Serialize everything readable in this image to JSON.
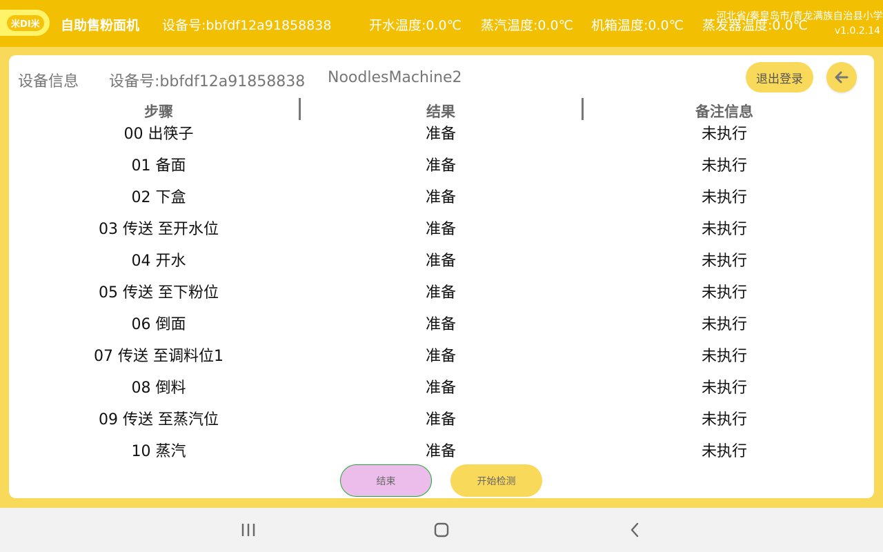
{
  "header": {
    "logo_text": "米DI米",
    "title": "自助售粉面机",
    "device": "设备号:bbfdf12a91858838",
    "water_temp": "开水温度:0.0℃",
    "steam_temp": "蒸汽温度:0.0℃",
    "cabinet_temp": "机箱温度:0.0℃",
    "evaporator_temp": "蒸发器温度:0.0℃",
    "location": "河北省/秦皇岛市/青龙满族自治县小学",
    "version": "v1.0.2.14"
  },
  "info": {
    "label": "设备信息",
    "device": "设备号:bbfdf12a91858838",
    "machine": "NoodlesMachine2",
    "logout": "退出登录",
    "back_icon": "arrow-left-icon"
  },
  "table": {
    "headers": {
      "step": "步骤",
      "result": "结果",
      "note": "备注信息"
    },
    "rows": [
      {
        "step": "00 出筷子",
        "result": "准备",
        "note": "未执行"
      },
      {
        "step": "01 备面",
        "result": "准备",
        "note": "未执行"
      },
      {
        "step": "02 下盒",
        "result": "准备",
        "note": "未执行"
      },
      {
        "step": "03 传送 至开水位",
        "result": "准备",
        "note": "未执行"
      },
      {
        "step": "04 开水",
        "result": "准备",
        "note": "未执行"
      },
      {
        "step": "05 传送 至下粉位",
        "result": "准备",
        "note": "未执行"
      },
      {
        "step": "06 倒面",
        "result": "准备",
        "note": "未执行"
      },
      {
        "step": "07 传送 至调料位1",
        "result": "准备",
        "note": "未执行"
      },
      {
        "step": "08 倒料",
        "result": "准备",
        "note": "未执行"
      },
      {
        "step": "09 传送 至蒸汽位",
        "result": "准备",
        "note": "未执行"
      },
      {
        "step": "10 蒸汽",
        "result": "准备",
        "note": "未执行"
      }
    ]
  },
  "actions": {
    "end": "结束",
    "start": "开始检测"
  },
  "navbar": {
    "recent_icon": "recent-apps-icon",
    "home_icon": "home-icon",
    "back_icon": "nav-back-icon"
  },
  "colors": {
    "header_bg": "#f2bf02",
    "page_bg": "#f9d95a",
    "end_button": "#ecbcea",
    "start_button": "#f9d95a"
  }
}
